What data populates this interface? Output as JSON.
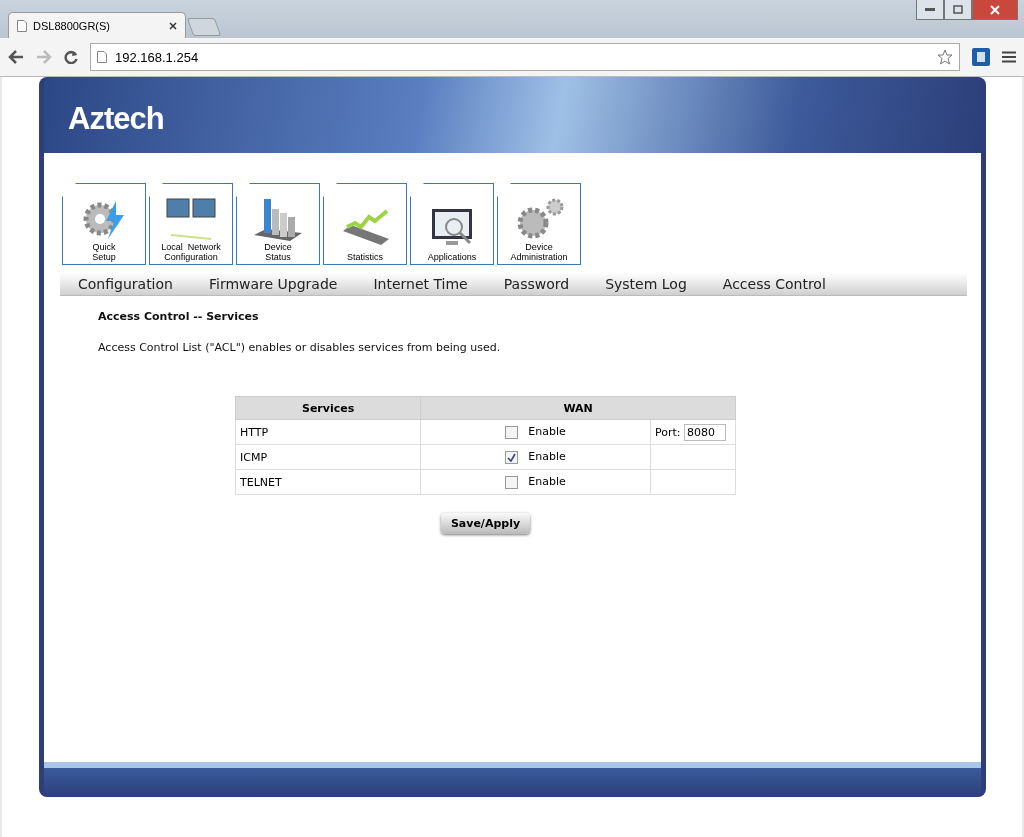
{
  "browser": {
    "tab_title": "DSL8800GR(S)",
    "url": "192.168.1.254"
  },
  "logo": "Aztech",
  "main_nav": [
    {
      "kind": "gear",
      "lines": [
        "Quick",
        "Setup"
      ]
    },
    {
      "kind": "monitors",
      "lines": [
        "Local  Network",
        "Configuration"
      ]
    },
    {
      "kind": "bars",
      "lines": [
        "Device",
        "Status"
      ]
    },
    {
      "kind": "graph",
      "lines": [
        "Statistics"
      ]
    },
    {
      "kind": "screen",
      "lines": [
        "Applications"
      ]
    },
    {
      "kind": "gears",
      "lines": [
        "Device",
        "Administration"
      ]
    }
  ],
  "sub_nav": [
    "Configuration",
    "Firmware Upgrade",
    "Internet Time",
    "Password",
    "System Log",
    "Access Control"
  ],
  "heading": "Access Control -- Services",
  "description": "Access Control List (\"ACL\") enables or disables services from being used.",
  "table": {
    "columns": [
      "Services",
      "WAN"
    ],
    "rows": [
      {
        "service": "HTTP",
        "checked": false,
        "enable_label": "Enable",
        "port_label": "Port:",
        "port": "8080"
      },
      {
        "service": "ICMP",
        "checked": true,
        "enable_label": "Enable"
      },
      {
        "service": "TELNET",
        "checked": false,
        "enable_label": "Enable"
      }
    ]
  },
  "save_button": "Save/Apply"
}
